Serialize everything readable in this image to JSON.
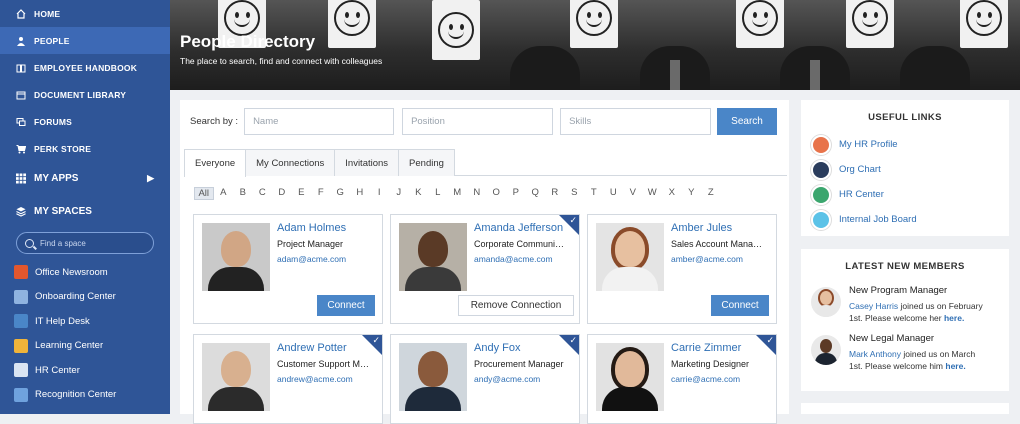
{
  "sidebar": {
    "nav": [
      {
        "label": "HOME",
        "icon": "home-icon"
      },
      {
        "label": "PEOPLE",
        "icon": "user-icon"
      },
      {
        "label": "EMPLOYEE HANDBOOK",
        "icon": "book-icon"
      },
      {
        "label": "DOCUMENT LIBRARY",
        "icon": "folder-icon"
      },
      {
        "label": "FORUMS",
        "icon": "chat-icon"
      },
      {
        "label": "PERK STORE",
        "icon": "cart-icon"
      }
    ],
    "my_apps": "MY APPS",
    "my_spaces": "MY SPACES",
    "space_search_placeholder": "Find a space",
    "spaces": [
      {
        "label": "Office Newsroom",
        "color": "#e2572e"
      },
      {
        "label": "Onboarding Center",
        "color": "#8fb3e0"
      },
      {
        "label": "IT Help Desk",
        "color": "#4a86c8"
      },
      {
        "label": "Learning Center",
        "color": "#f0b43a"
      },
      {
        "label": "HR Center",
        "color": "#d9e4f2"
      },
      {
        "label": "Recognition Center",
        "color": "#6fa2de"
      }
    ]
  },
  "banner": {
    "title": "People Directory",
    "subtitle": "The place to search, find and connect with colleagues"
  },
  "search": {
    "label": "Search by :",
    "name_placeholder": "Name",
    "position_placeholder": "Position",
    "skills_placeholder": "Skills",
    "button": "Search"
  },
  "tabs": [
    "Everyone",
    "My Connections",
    "Invitations",
    "Pending"
  ],
  "alphabet": [
    "All",
    "A",
    "B",
    "C",
    "D",
    "E",
    "F",
    "G",
    "H",
    "I",
    "J",
    "K",
    "L",
    "M",
    "N",
    "O",
    "P",
    "Q",
    "R",
    "S",
    "T",
    "U",
    "V",
    "W",
    "X",
    "Y",
    "Z"
  ],
  "people": [
    {
      "name": "Adam Holmes",
      "title": "Project Manager",
      "email": "adam@acme.com",
      "action": "Connect"
    },
    {
      "name": "Amanda Jefferson",
      "title": "Corporate Communi…",
      "email": "amanda@acme.com",
      "action": "Remove Connection"
    },
    {
      "name": "Amber Jules",
      "title": "Sales Account Mana…",
      "email": "amber@acme.com",
      "action": "Connect"
    },
    {
      "name": "Andrew Potter",
      "title": "Customer Support M…",
      "email": "andrew@acme.com"
    },
    {
      "name": "Andy Fox",
      "title": "Procurement Manager",
      "email": "andy@acme.com"
    },
    {
      "name": "Carrie Zimmer",
      "title": "Marketing Designer",
      "email": "carrie@acme.com"
    }
  ],
  "useful_links": {
    "title": "USEFUL LINKS",
    "items": [
      {
        "label": "My HR Profile",
        "color": "#e8734a"
      },
      {
        "label": "Org Chart",
        "color": "#2a3c5c"
      },
      {
        "label": "HR Center",
        "color": "#3ba66e"
      },
      {
        "label": "Internal Job Board",
        "color": "#5bc2e7"
      }
    ]
  },
  "latest_members": {
    "title": "LATEST NEW MEMBERS",
    "items": [
      {
        "role": "New Program Manager",
        "name": "Casey Harris",
        "text1": "joined us on February",
        "text2": "1st. Please welcome her",
        "here": "here."
      },
      {
        "role": "New Legal Manager",
        "name": "Mark Anthony",
        "text1": "joined us on March",
        "text2": "1st. Please welcome him",
        "here": "here."
      }
    ]
  },
  "colors": {
    "sidebar": "#2f5597",
    "accent": "#4a86c8",
    "link": "#2f6fb4"
  }
}
